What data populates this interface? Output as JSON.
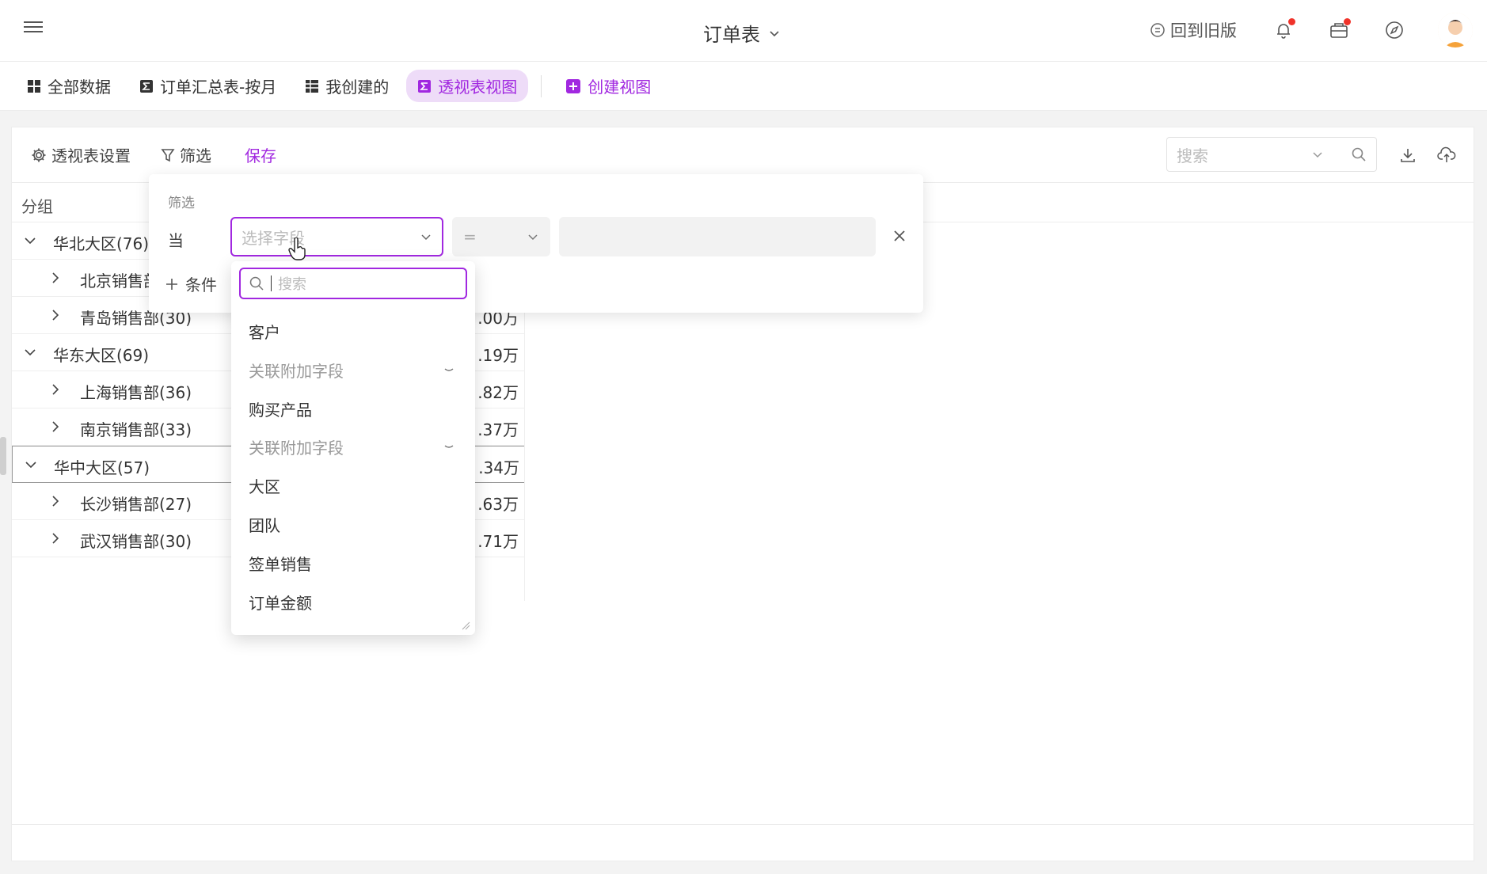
{
  "header": {
    "title": "订单表",
    "old_version": "回到旧版"
  },
  "tabs": [
    {
      "label": "全部数据"
    },
    {
      "label": "订单汇总表-按月"
    },
    {
      "label": "我创建的"
    },
    {
      "label": "透视表视图"
    },
    {
      "label": "创建视图"
    }
  ],
  "toolbar": {
    "pivot_settings": "透视表设置",
    "filter": "筛选",
    "save": "保存",
    "search_placeholder": "搜索"
  },
  "table": {
    "group_header": "分组",
    "rows": [
      {
        "label": "华北大区(76)",
        "value": ""
      },
      {
        "label": "北京销售部",
        "value": ""
      },
      {
        "label": "青岛销售部(30)",
        "value": ".00万"
      },
      {
        "label": "华东大区(69)",
        "value": ".19万"
      },
      {
        "label": "上海销售部(36)",
        "value": ".82万"
      },
      {
        "label": "南京销售部(33)",
        "value": ".37万"
      },
      {
        "label": "华中大区(57)",
        "value": ".34万"
      },
      {
        "label": "长沙销售部(27)",
        "value": ".63万"
      },
      {
        "label": "武汉销售部(30)",
        "value": ".71万"
      }
    ]
  },
  "filter_panel": {
    "title": "筛选",
    "when": "当",
    "field_placeholder": "选择字段",
    "operator": "=",
    "add_condition": "条件"
  },
  "field_dropdown": {
    "search_placeholder": "搜索",
    "items": [
      {
        "label": "客户"
      },
      {
        "label": "关联附加字段"
      },
      {
        "label": "购买产品"
      },
      {
        "label": "关联附加字段"
      },
      {
        "label": "大区"
      },
      {
        "label": "团队"
      },
      {
        "label": "签单销售"
      },
      {
        "label": "订单金额"
      }
    ]
  },
  "colors": {
    "accent": "#a128e0",
    "accent_bg": "#eedcf8",
    "badge": "#f0332a"
  }
}
